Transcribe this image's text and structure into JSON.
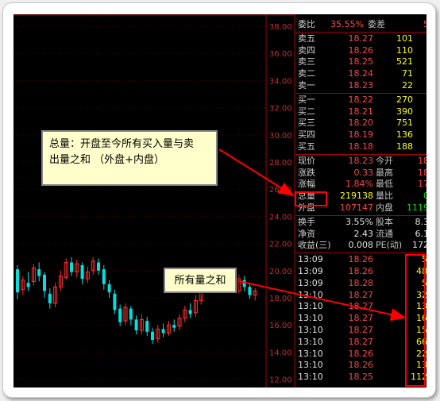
{
  "axis_labels": [
    "38.00",
    "36.00",
    "34.00",
    "32.00",
    "30.00",
    "28.00",
    "26.00",
    "24.00",
    "22.00",
    "20.00",
    "18.00",
    "16.00",
    "14.00",
    "12.00"
  ],
  "order_book": {
    "ratio": {
      "label": "委比",
      "value": "35.55%",
      "label2": "委差",
      "value2": "5"
    },
    "sells": [
      {
        "label": "卖五",
        "price": "18.27",
        "vol": "101"
      },
      {
        "label": "卖四",
        "price": "18.26",
        "vol": "110"
      },
      {
        "label": "卖三",
        "price": "18.25",
        "vol": "521"
      },
      {
        "label": "卖二",
        "price": "18.24",
        "vol": "71"
      },
      {
        "label": "卖一",
        "price": "18.23",
        "vol": "22"
      }
    ],
    "buys": [
      {
        "label": "买一",
        "price": "18.22",
        "vol": "270"
      },
      {
        "label": "买二",
        "price": "18.21",
        "vol": "390"
      },
      {
        "label": "买三",
        "price": "18.20",
        "vol": "751"
      },
      {
        "label": "买四",
        "price": "18.19",
        "vol": "136"
      },
      {
        "label": "买五",
        "price": "18.18",
        "vol": "188"
      }
    ]
  },
  "stats": [
    {
      "label": "现价",
      "value": "18.23",
      "label2": "今开",
      "value2": "18"
    },
    {
      "label": "涨跌",
      "value": "0.33",
      "label2": "最高",
      "value2": "18"
    },
    {
      "label": "涨幅",
      "value": "1.84%",
      "label2": "最低",
      "value2": "17"
    },
    {
      "label": "总量",
      "value": "219138",
      "label2": "量比",
      "value2": "0"
    },
    {
      "label": "外盘",
      "value": "107147",
      "label2": "内盘",
      "value2": "1119"
    }
  ],
  "finance": [
    {
      "label": "换手",
      "value": "3.55%",
      "label2": "股本",
      "value2": "8.3"
    },
    {
      "label": "净资",
      "value": "2.43",
      "label2": "流通",
      "value2": "6.1"
    },
    {
      "label": "收益(三)",
      "value": "0.008",
      "label2": "PE(动)",
      "value2": "172"
    }
  ],
  "ticks": [
    {
      "time": "13:09",
      "price": "18.26",
      "vol": "5"
    },
    {
      "time": "13:09",
      "price": "18.26",
      "vol": "48"
    },
    {
      "time": "13:09",
      "price": "18.28",
      "vol": "5"
    },
    {
      "time": "13:10",
      "price": "18.27",
      "vol": "32"
    },
    {
      "time": "13:10",
      "price": "18.27",
      "vol": "13"
    },
    {
      "time": "13:10",
      "price": "18.27",
      "vol": "16"
    },
    {
      "time": "13:10",
      "price": "18.27",
      "vol": "15"
    },
    {
      "time": "13:10",
      "price": "18.27",
      "vol": "66"
    },
    {
      "time": "13:10",
      "price": "18.26",
      "vol": "22"
    },
    {
      "time": "13:10",
      "price": "18.26",
      "vol": "13"
    },
    {
      "time": "13:10",
      "price": "18.25",
      "vol": "112"
    }
  ],
  "callouts": {
    "total_volume_line1": "总量：开盘至今所有买入量与卖",
    "total_volume_line2": "出量之和 （外盘+内盘）",
    "all_volume": "所有量之和"
  }
}
